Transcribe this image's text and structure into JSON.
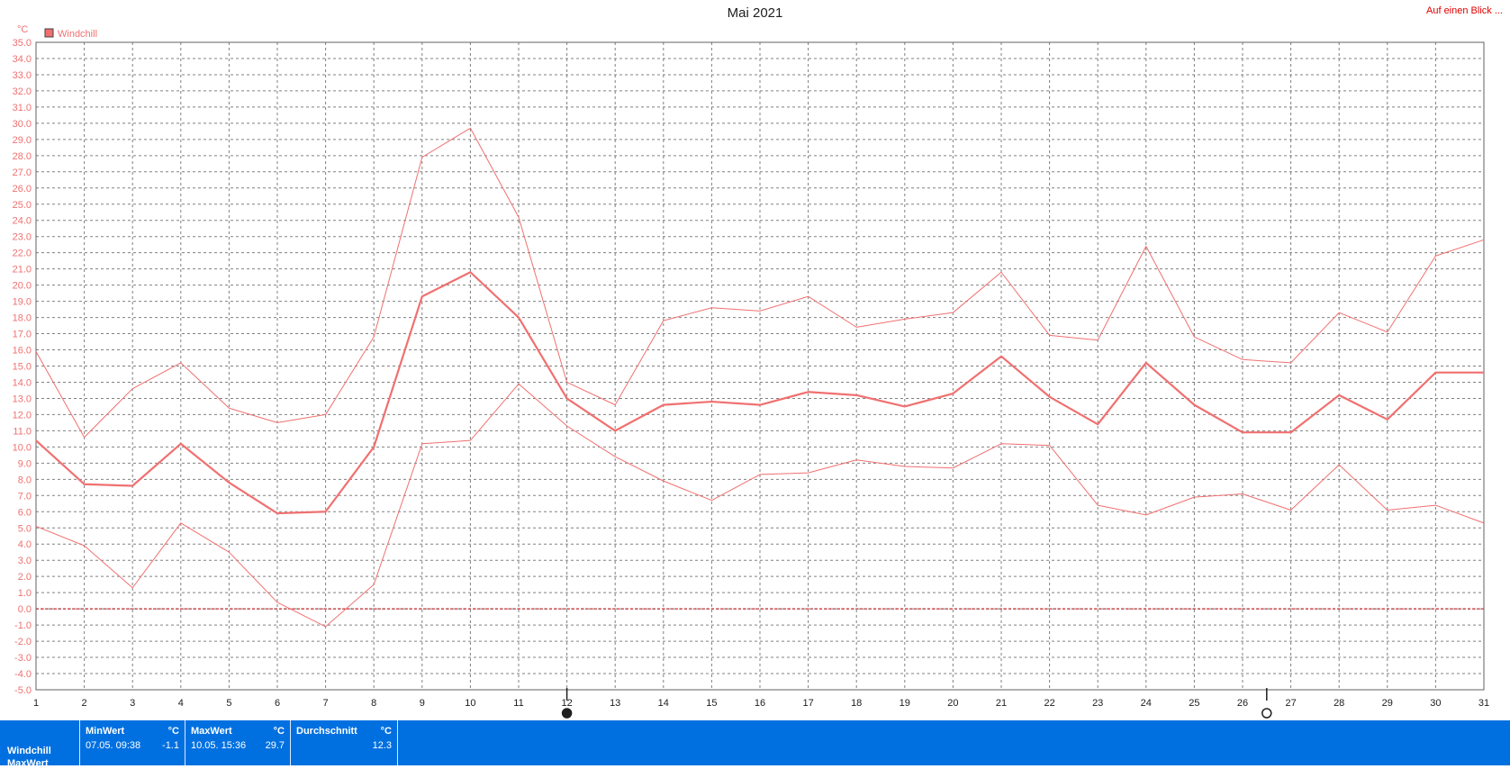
{
  "header": {
    "title": "Mai 2021",
    "summary_link": "Auf einen Blick ..."
  },
  "colors": {
    "series": "#f07070",
    "zero_line": "#c00000",
    "grid": "#808080",
    "axis_text": "#f07070",
    "day_text": "#202020",
    "stats_bg": "#0070e0"
  },
  "chart_data": {
    "type": "line",
    "title": "Mai 2021",
    "ylabel": "°C",
    "ylim": [
      -5.0,
      35.0
    ],
    "y_tick_step": 1.0,
    "xlim": [
      1,
      31
    ],
    "x": [
      1,
      2,
      3,
      4,
      5,
      6,
      7,
      8,
      9,
      10,
      11,
      12,
      13,
      14,
      15,
      16,
      17,
      18,
      19,
      20,
      21,
      22,
      23,
      24,
      25,
      26,
      27,
      28,
      29,
      30,
      31
    ],
    "grid": true,
    "zero_line": true,
    "legend": {
      "position": "top-left",
      "entries": [
        "Windchill"
      ]
    },
    "series": [
      {
        "name": "Windchill",
        "role": "mean",
        "values": [
          10.4,
          7.7,
          7.6,
          10.2,
          7.8,
          5.9,
          6.0,
          10.0,
          19.3,
          20.8,
          18.0,
          13.0,
          11.0,
          12.6,
          12.8,
          12.6,
          13.4,
          13.2,
          12.5,
          13.3,
          15.6,
          13.1,
          11.4,
          15.2,
          12.6,
          10.9,
          10.9,
          13.2,
          11.7,
          14.6,
          14.6
        ]
      },
      {
        "role": "max",
        "values": [
          15.9,
          10.6,
          13.6,
          15.2,
          12.4,
          11.5,
          12.0,
          16.8,
          27.9,
          29.7,
          24.2,
          14.0,
          12.6,
          17.8,
          18.6,
          18.4,
          19.3,
          17.4,
          17.9,
          18.3,
          20.8,
          16.9,
          16.6,
          22.4,
          16.8,
          15.4,
          15.2,
          18.3,
          17.1,
          21.8,
          22.8
        ]
      },
      {
        "role": "min",
        "values": [
          5.1,
          3.9,
          1.3,
          5.3,
          3.5,
          0.4,
          -1.1,
          1.5,
          10.2,
          10.4,
          13.9,
          11.3,
          9.4,
          7.9,
          6.7,
          8.3,
          8.4,
          9.2,
          8.8,
          8.7,
          10.2,
          10.1,
          6.4,
          5.8,
          6.9,
          7.1,
          6.1,
          8.9,
          6.1,
          6.4,
          5.3
        ]
      }
    ],
    "markers": [
      {
        "day": 12,
        "symbol": "new-moon"
      },
      {
        "day": 26.5,
        "symbol": "full-moon"
      }
    ]
  },
  "stats": {
    "rows": [
      "Windchill",
      "MaxWert"
    ],
    "min": {
      "header": "MinWert",
      "unit": "°C",
      "time": "07.05.  09:38",
      "value": "-1.1"
    },
    "max": {
      "header": "MaxWert",
      "unit": "°C",
      "time": "10.05.  15:36",
      "value": "29.7"
    },
    "avg": {
      "header": "Durchschnitt",
      "unit": "°C",
      "value": "12.3"
    }
  }
}
